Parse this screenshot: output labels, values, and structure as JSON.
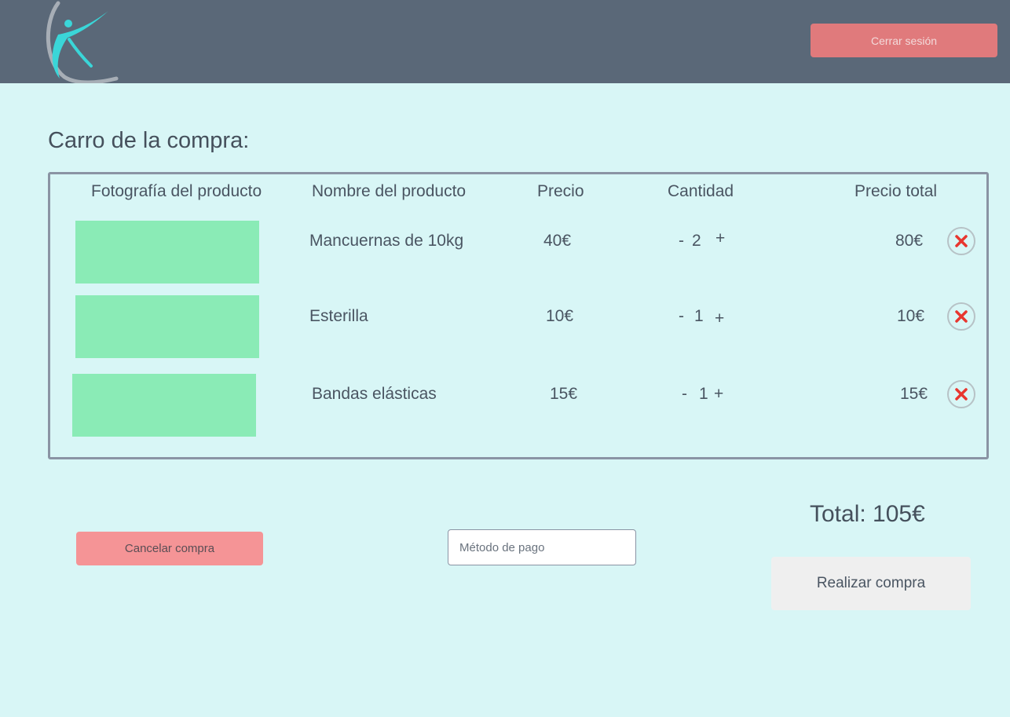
{
  "header": {
    "logout_label": "Cerrar sesión"
  },
  "page_title": "Carro de la compra:",
  "table": {
    "headers": {
      "photo": "Fotografía del producto",
      "name": "Nombre del producto",
      "price": "Precio",
      "quantity": "Cantidad",
      "total": "Precio total"
    },
    "rows": [
      {
        "name": "Mancuernas de 10kg",
        "price": "40€",
        "minus": "-",
        "qty": "2",
        "plus": "+",
        "total": "80€"
      },
      {
        "name": "Esterilla",
        "price": "10€",
        "minus": "-",
        "qty": "1",
        "plus": "+",
        "total": "10€"
      },
      {
        "name": "Bandas elásticas",
        "price": "15€",
        "minus": "-",
        "qty": "1",
        "plus": "+",
        "total": "15€"
      }
    ]
  },
  "summary": {
    "total": "Total: 105€"
  },
  "actions": {
    "cancel_label": "Cancelar compra",
    "payment_placeholder": "Método de pago",
    "buy_label": "Realizar compra"
  },
  "colors": {
    "header_bg": "#5a6878",
    "page_bg": "#d8f6f6",
    "photo_placeholder": "#8aebb6",
    "remove_icon": "#e8362f",
    "logo_accent": "#3ad6d8"
  },
  "icons": {
    "logo": "fitness-logo-icon",
    "remove": "close-icon"
  }
}
